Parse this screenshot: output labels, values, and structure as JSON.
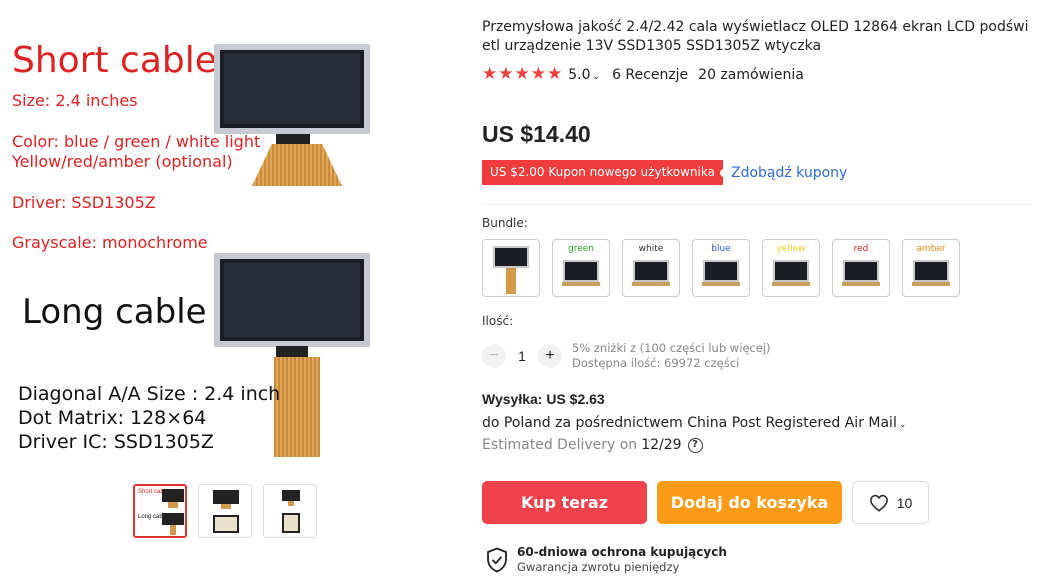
{
  "product_image": {
    "short_title": "Short cable",
    "specs": [
      "Size: 2.4 inches",
      "Color: blue / green / white light",
      "Yellow/red/amber (optional)",
      "Driver: SSD1305Z",
      "Grayscale: monochrome"
    ],
    "long_title": "Long cable",
    "long_specs": [
      "Diagonal A/A Size :   2.4 inch",
      "Dot Matrix: 128×64",
      "Driver IC: SSD1305Z"
    ],
    "thumb_text": {
      "short": "Short cable",
      "long": "Long cable"
    }
  },
  "product": {
    "title": "Przemysłowa jakość 2.4/2.42 cala wyświetlacz OLED 12864 ekran LCD podświetl urządzenie 13V SSD1305 SSD1305Z wtyczka",
    "rating": "5.0",
    "reviews": "6 Recenzje",
    "orders": "20 zamówienia",
    "price": "US $14.40",
    "coupon": "US $2.00 Kupon nowego użytkownika",
    "get_coupons": "Zdobądź kupony"
  },
  "bundle": {
    "label": "Bundle:",
    "options": [
      {
        "label": "",
        "color": "#333333"
      },
      {
        "label": "green",
        "color": "#2aa52a"
      },
      {
        "label": "white",
        "color": "#333333"
      },
      {
        "label": "blue",
        "color": "#2f58d8"
      },
      {
        "label": "yellow",
        "color": "#e8d21c"
      },
      {
        "label": "red",
        "color": "#e02020"
      },
      {
        "label": "amber",
        "color": "#f08a1a"
      }
    ]
  },
  "quantity": {
    "label": "Ilość:",
    "value": "1",
    "minus": "−",
    "plus": "+",
    "discount_note": "5% zniżki z (100 części lub więcej)",
    "available": "Dostępna ilość: 69972 części"
  },
  "shipping": {
    "title": "Wysyłka: US $2.63",
    "route": "do Poland za pośrednictwem China Post Registered Air Mail",
    "delivery_label": "Estimated Delivery on",
    "delivery_date": "12/29",
    "help": "?"
  },
  "actions": {
    "buy_now": "Kup teraz",
    "add_to_cart": "Dodaj do koszyka",
    "wishlist_count": "10"
  },
  "protection": {
    "title": "60-dniowa ochrona kupujących",
    "subtitle": "Gwarancja zwrotu pieniędzy"
  },
  "colors": {
    "accent_red": "#f0424b",
    "accent_orange": "#fd9a16",
    "link_blue": "#2d6bd8",
    "star": "#e8423e"
  }
}
